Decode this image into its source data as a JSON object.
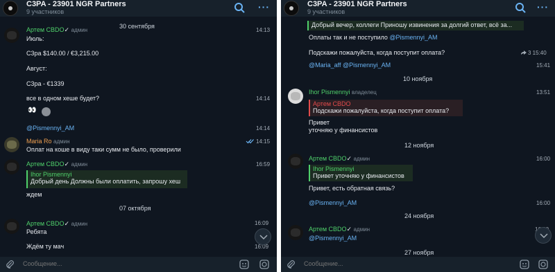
{
  "left": {
    "header": {
      "title": "C3PA - 23901 NGR Partners",
      "subtitle": "9 участников"
    },
    "date_1": "30 сентября",
    "date_2": "07 октября",
    "messages": [
      {
        "name": "Артем CBDO",
        "role": "админ",
        "text": "Июль:",
        "time": "14:13"
      },
      {
        "text": "C3ра $140.00 / €3,215.00"
      },
      {
        "text": "Август:"
      },
      {
        "text": "C3ра - €1339"
      },
      {
        "text": "все в одном хеше будет?",
        "time": "14:14"
      },
      {
        "eyes": "👀"
      },
      {
        "text": "@Pismennyi_AM",
        "time": "14:14"
      },
      {
        "name": "Maria Ro",
        "role": "админ",
        "text": "Оплат на коше в виду таки сумм не было, проверили",
        "time": "14:15"
      },
      {
        "name": "Артем CBDO",
        "role": "админ",
        "time": "16:59",
        "reply_name": "Ihor Pismennyi",
        "reply_text": "Добрый день Должны были оплатить, запрошу хеш",
        "text": "ждем"
      },
      {
        "name": "Артем CBDO",
        "role": "админ",
        "text": "Ребята",
        "time": "16:09"
      },
      {
        "text": "Ждём ту мач",
        "time": "16:09"
      }
    ],
    "composer": {
      "placeholder": "Сообщение..."
    }
  },
  "right": {
    "header": {
      "title": "C3PA - 23901 NGR Partners",
      "subtitle": "9 участников"
    },
    "messages": [
      {
        "reply_text": "Добрый вечер, коллеги Приношу извинения за долгий ответ, всё за..."
      },
      {
        "text": "Оплаты так и не поступило",
        "link": "@Pismennyi_AM"
      },
      {
        "text": "Подскажи пожалуйста, когда поступит оплата?",
        "fwd_time": "3 15:40"
      },
      {
        "link": "@Maria_aff @Pismennyi_AM",
        "time": "15:41"
      },
      {
        "name": "Ihor Pismennyi",
        "role": "владелец",
        "time": "13:51",
        "reply_name": "Артем CBDO",
        "reply_text": "Подскажи пожалуйста, когда поступит оплата?",
        "text": "Привет",
        "text2": "уточняю у финансистов"
      },
      {
        "name": "Артем CBDO",
        "role": "админ",
        "time": "16:00",
        "reply_name": "Ihor Pismennyi",
        "reply_text": "Привет  уточняю у финансистов",
        "text": "Привет, есть обратная связь?"
      },
      {
        "link": "@Pismennyi_AM",
        "time": "16:00"
      },
      {
        "name": "Артем CBDO",
        "role": "админ",
        "link": "@Pismennyi_AM",
        "time": "16:00"
      }
    ],
    "dates": [
      "10 ноября",
      "12 ноября",
      "24 ноября",
      "27 ноября"
    ],
    "composer": {
      "placeholder": "Сообщение..."
    }
  },
  "colors": {
    "background": "#0f1620",
    "header": "#17212b",
    "name_green": "#4fd06a",
    "link_blue": "#6ab3f3",
    "reply_red": "#e24b4b"
  },
  "icons": [
    "search-icon",
    "more-icon",
    "attach-icon",
    "sticker-icon",
    "camera-icon",
    "scroll-down-icon",
    "double-check-icon",
    "forward-icon"
  ]
}
